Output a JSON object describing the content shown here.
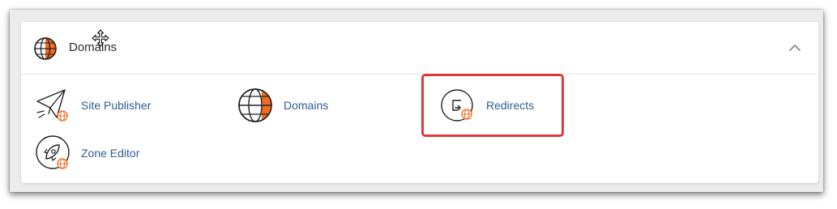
{
  "section": {
    "title": "Domains",
    "icon": "globe-icon",
    "collapse_icon": "chevron-up-icon"
  },
  "tools": [
    {
      "label": "Site Publisher",
      "icon": "paper-plane-globe-icon"
    },
    {
      "label": "Domains",
      "icon": "globe-icon"
    },
    {
      "label": "Redirects",
      "icon": "redirect-arrow-globe-icon"
    },
    {
      "label": "Zone Editor",
      "icon": "rocket-globe-icon"
    }
  ],
  "colors": {
    "accent_orange": "#f26b21",
    "link_blue": "#2d5d93",
    "highlight_red": "#e0393d"
  }
}
